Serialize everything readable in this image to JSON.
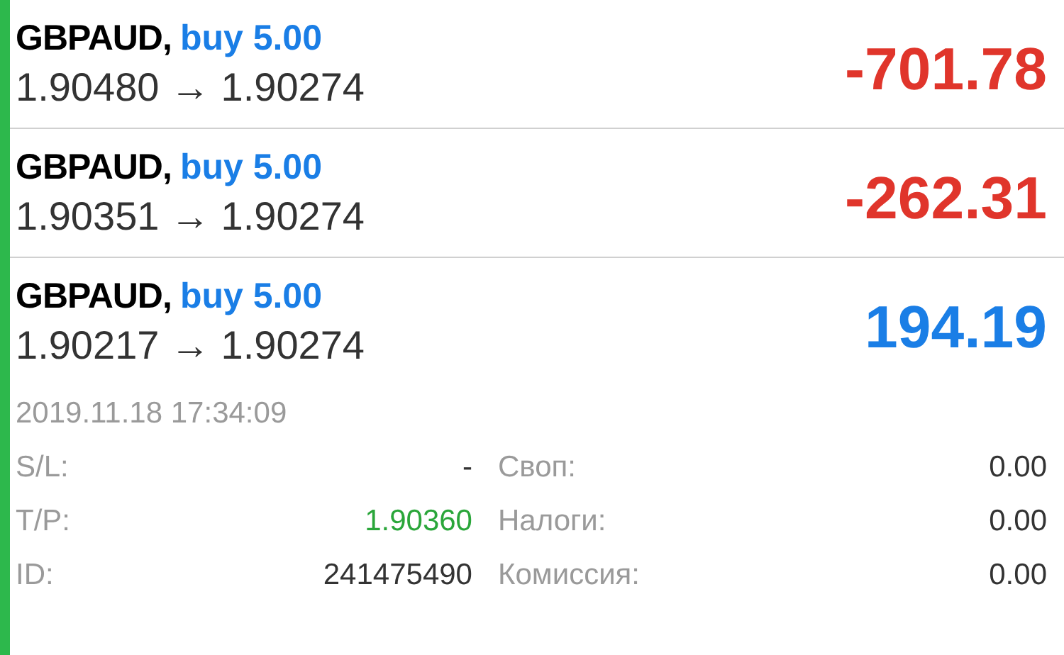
{
  "positions": [
    {
      "symbol": "GBPAUD,",
      "order": "buy 5.00",
      "prices": "1.90480 → 1.90274",
      "profit": "-701.78",
      "kind": "loss",
      "expanded": false
    },
    {
      "symbol": "GBPAUD,",
      "order": "buy 5.00",
      "prices": "1.90351 → 1.90274",
      "profit": "-262.31",
      "kind": "loss",
      "expanded": false
    },
    {
      "symbol": "GBPAUD,",
      "order": "buy 5.00",
      "prices": "1.90217 → 1.90274",
      "profit": "194.19",
      "kind": "gain",
      "expanded": true,
      "time": "2019.11.18 17:34:09",
      "details": [
        {
          "label": "S/L:",
          "value": "-",
          "kind": "plain",
          "label_2": "Своп:",
          "value_2": "0.00"
        },
        {
          "label": "T/P:",
          "value": "1.90360",
          "kind": "target",
          "label_2": "Налоги:",
          "value_2": "0.00"
        },
        {
          "label": "ID:",
          "value": "241475490",
          "kind": "plain",
          "label_2": "Комиссия:",
          "value_2": "0.00"
        }
      ]
    }
  ]
}
